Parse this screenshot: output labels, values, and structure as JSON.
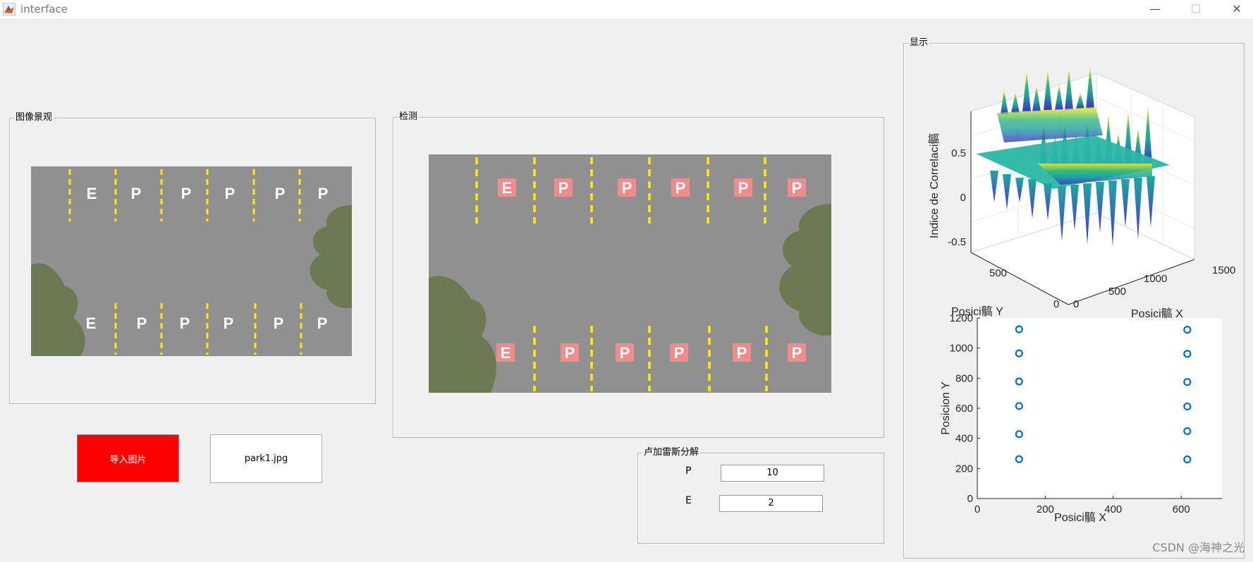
{
  "window": {
    "title": "interface",
    "controls": [
      "—",
      "☐",
      "✕"
    ]
  },
  "panels": {
    "preview": {
      "title": "图像景观"
    },
    "detect": {
      "title": "检测"
    },
    "display": {
      "title": "显示"
    },
    "decomp": {
      "title": "卢加雷斯分解"
    }
  },
  "lot": {
    "top_labels": [
      "E",
      "P",
      "P",
      "P",
      "P",
      "P"
    ],
    "bottom_labels": [
      "E",
      "P",
      "P",
      "P",
      "P",
      "P"
    ]
  },
  "buttons": {
    "import_label": "导入图片",
    "filename": "park1.jpg",
    "import_color": "#ff0000"
  },
  "fields": {
    "p_label": "P",
    "p_value": "10",
    "e_label": "E",
    "e_value": "2"
  },
  "watermark": "CSDN @海神之光",
  "chart_data": [
    {
      "type": "surface",
      "zlabel": "Indice de Correlaci髇",
      "xlabel": "Posici髇 X",
      "ylabel": "Posici髇 Y",
      "z_ticks": [
        "0.5",
        "0",
        "-0.5"
      ],
      "x_ticks": [
        "0",
        "500",
        "1000",
        "1500"
      ],
      "y_ticks": [
        "0",
        "500"
      ],
      "zlim": [
        -0.6,
        0.6
      ],
      "colormap": "parula"
    },
    {
      "type": "scatter",
      "xlabel": "Posici髇 X",
      "ylabel": "Posicion Y",
      "xlim": [
        0,
        720
      ],
      "ylim": [
        0,
        1200
      ],
      "x_ticks": [
        0,
        200,
        400,
        600
      ],
      "y_ticks": [
        0,
        200,
        400,
        600,
        800,
        1000,
        1200
      ],
      "marker_color": "#0072bd",
      "points": [
        {
          "x": 123,
          "y": 1125
        },
        {
          "x": 123,
          "y": 965
        },
        {
          "x": 123,
          "y": 778
        },
        {
          "x": 123,
          "y": 615
        },
        {
          "x": 123,
          "y": 428
        },
        {
          "x": 123,
          "y": 262
        },
        {
          "x": 618,
          "y": 1122
        },
        {
          "x": 618,
          "y": 962
        },
        {
          "x": 618,
          "y": 775
        },
        {
          "x": 618,
          "y": 612
        },
        {
          "x": 618,
          "y": 448
        },
        {
          "x": 618,
          "y": 260
        }
      ]
    }
  ]
}
